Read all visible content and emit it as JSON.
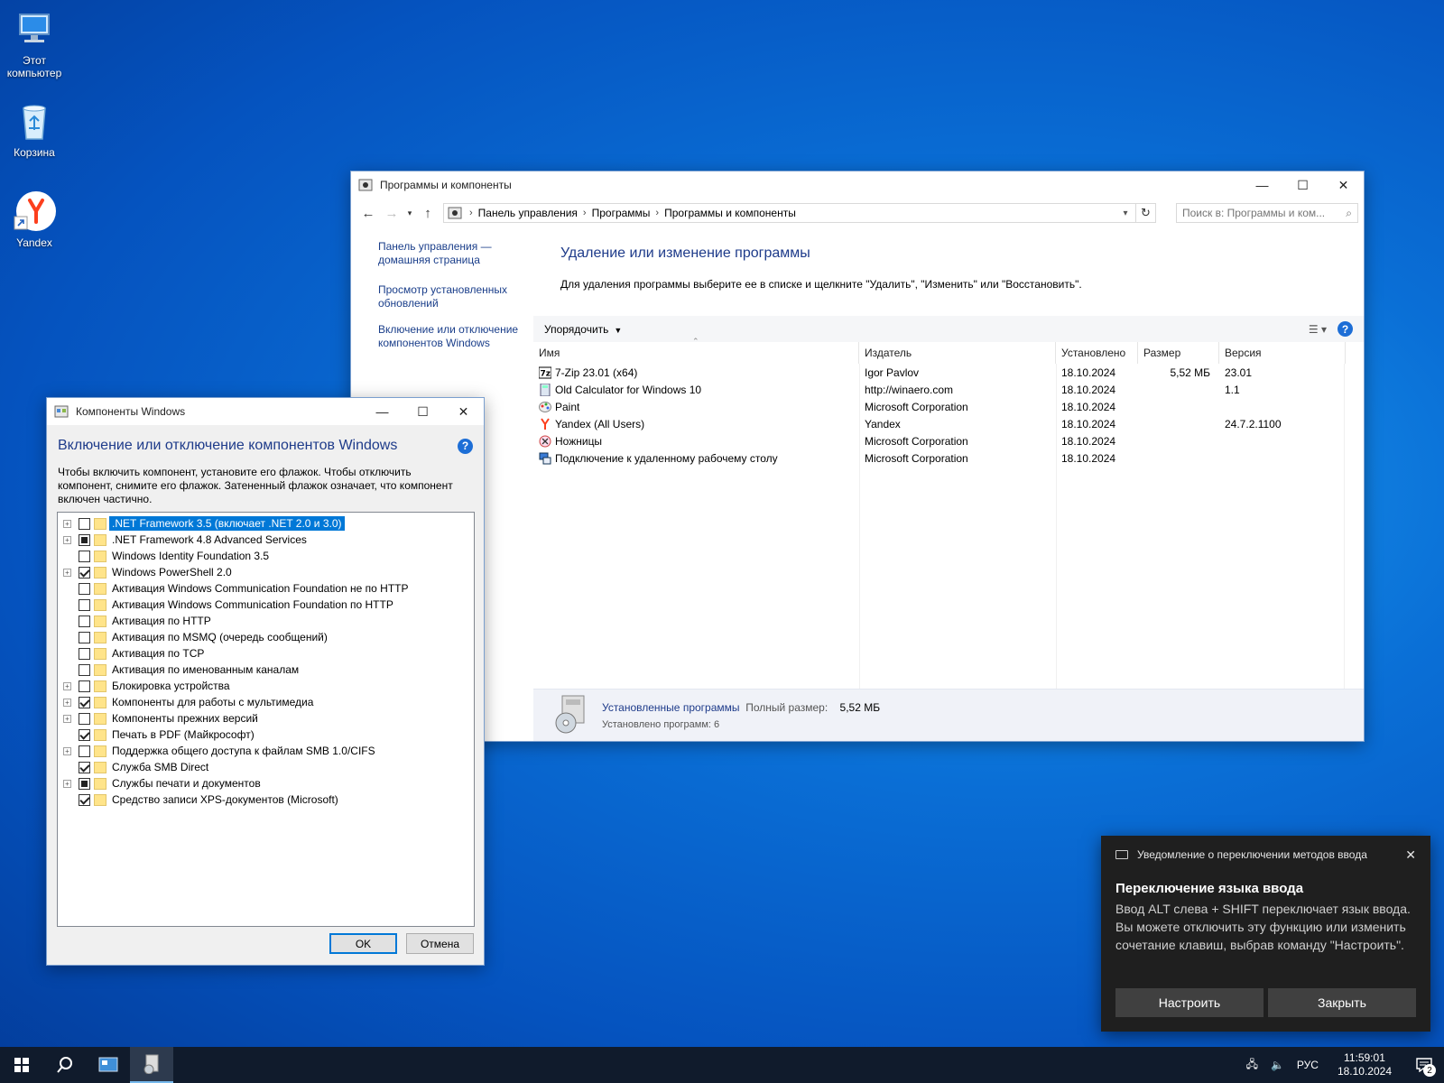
{
  "desktop": {
    "icons": [
      {
        "label_line1": "Этот",
        "label_line2": "компьютер"
      },
      {
        "label_line1": "Корзина",
        "label_line2": ""
      },
      {
        "label_line1": "Yandex",
        "label_line2": ""
      }
    ]
  },
  "control_panel": {
    "title": "Программы и компоненты",
    "breadcrumb": [
      "Панель управления",
      "Программы",
      "Программы и компоненты"
    ],
    "search_placeholder": "Поиск в: Программы и ком...",
    "left_links": [
      {
        "line1": "Панель управления —",
        "line2": "домашняя страница"
      },
      {
        "line1": "Просмотр установленных",
        "line2": "обновлений"
      },
      {
        "line1": "Включение или отключение",
        "line2": "компонентов Windows"
      }
    ],
    "heading": "Удаление или изменение программы",
    "description": "Для удаления программы выберите ее в списке и щелкните \"Удалить\", \"Изменить\" или \"Восстановить\".",
    "organize_label": "Упорядочить",
    "columns": [
      "Имя",
      "Издатель",
      "Установлено",
      "Размер",
      "Версия"
    ],
    "rows": [
      {
        "name": "7-Zip 23.01 (x64)",
        "publisher": "Igor Pavlov",
        "installed": "18.10.2024",
        "size": "5,52 МБ",
        "version": "23.01",
        "icon": "7zip-icon"
      },
      {
        "name": "Old Calculator for Windows 10",
        "publisher": "http://winaero.com",
        "installed": "18.10.2024",
        "size": "",
        "version": "1.1",
        "icon": "calculator-icon"
      },
      {
        "name": "Paint",
        "publisher": "Microsoft Corporation",
        "installed": "18.10.2024",
        "size": "",
        "version": "",
        "icon": "paint-icon"
      },
      {
        "name": "Yandex (All Users)",
        "publisher": "Yandex",
        "installed": "18.10.2024",
        "size": "",
        "version": "24.7.2.1100",
        "icon": "yandex-icon"
      },
      {
        "name": "Ножницы",
        "publisher": "Microsoft Corporation",
        "installed": "18.10.2024",
        "size": "",
        "version": "",
        "icon": "scissors-icon"
      },
      {
        "name": "Подключение к удаленному рабочему столу",
        "publisher": "Microsoft Corporation",
        "installed": "18.10.2024",
        "size": "",
        "version": "",
        "icon": "remote-desktop-icon"
      }
    ],
    "status": {
      "main": "Установленные программы",
      "size_label": "Полный размер:",
      "size_value": "5,52 МБ",
      "count": "Установлено программ: 6"
    }
  },
  "features": {
    "title": "Компоненты Windows",
    "heading": "Включение или отключение компонентов Windows",
    "description_lines": [
      "Чтобы включить компонент, установите его флажок. Чтобы отключить",
      "компонент, снимите его флажок. Затененный флажок означает, что компонент",
      "включен частично."
    ],
    "items": [
      {
        "label": ".NET Framework 3.5 (включает .NET 2.0 и 3.0)",
        "state": "off",
        "expand": true,
        "selected": true
      },
      {
        "label": ".NET Framework 4.8 Advanced Services",
        "state": "part",
        "expand": true,
        "selected": false
      },
      {
        "label": "Windows Identity Foundation 3.5",
        "state": "off",
        "expand": false,
        "selected": false
      },
      {
        "label": "Windows PowerShell 2.0",
        "state": "on",
        "expand": true,
        "selected": false
      },
      {
        "label": "Активация Windows Communication Foundation не по HTTP",
        "state": "off",
        "expand": false,
        "selected": false
      },
      {
        "label": "Активация Windows Communication Foundation по HTTP",
        "state": "off",
        "expand": false,
        "selected": false
      },
      {
        "label": "Активация по HTTP",
        "state": "off",
        "expand": false,
        "selected": false
      },
      {
        "label": "Активация по MSMQ (очередь сообщений)",
        "state": "off",
        "expand": false,
        "selected": false
      },
      {
        "label": "Активация по TCP",
        "state": "off",
        "expand": false,
        "selected": false
      },
      {
        "label": "Активация по именованным каналам",
        "state": "off",
        "expand": false,
        "selected": false
      },
      {
        "label": "Блокировка устройства",
        "state": "off",
        "expand": true,
        "selected": false
      },
      {
        "label": "Компоненты для работы с мультимедиа",
        "state": "on",
        "expand": true,
        "selected": false
      },
      {
        "label": "Компоненты прежних версий",
        "state": "off",
        "expand": true,
        "selected": false
      },
      {
        "label": "Печать в PDF (Майкрософт)",
        "state": "on",
        "expand": false,
        "selected": false
      },
      {
        "label": "Поддержка общего доступа к файлам SMB 1.0/CIFS",
        "state": "off",
        "expand": true,
        "selected": false
      },
      {
        "label": "Служба SMB Direct",
        "state": "on",
        "expand": false,
        "selected": false
      },
      {
        "label": "Службы печати и документов",
        "state": "part",
        "expand": true,
        "selected": false
      },
      {
        "label": "Средство записи XPS-документов (Microsoft)",
        "state": "on",
        "expand": false,
        "selected": false
      }
    ],
    "ok_label": "OK",
    "cancel_label": "Отмена"
  },
  "toast": {
    "app_title": "Уведомление о переключении методов ввода",
    "heading": "Переключение языка ввода",
    "body": "Ввод ALT слева + SHIFT переключает язык ввода. Вы можете отключить эту функцию или изменить сочетание клавиш, выбрав команду \"Настроить\".",
    "configure_label": "Настроить",
    "close_label": "Закрыть"
  },
  "taskbar": {
    "language": "РУС",
    "time": "11:59:01",
    "date": "18.10.2024",
    "notification_count": "2"
  },
  "colors": {
    "accent": "#0078d7",
    "link": "#1a3e8a",
    "heading": "#1e3b8a",
    "taskbar": "#101b2c",
    "toast_bg": "#1f1f1f"
  }
}
